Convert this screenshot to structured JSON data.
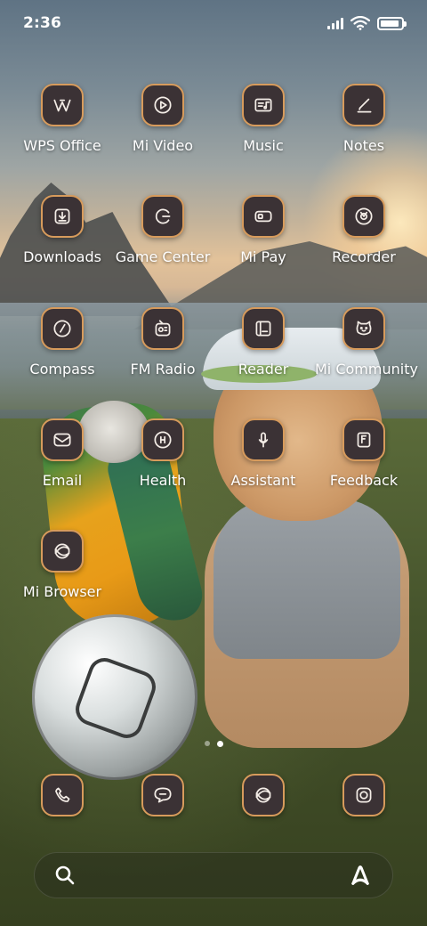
{
  "status_bar": {
    "time": "2:36",
    "signal_icon": "signal-bars-icon",
    "wifi_icon": "wifi-icon",
    "battery_icon": "battery-icon",
    "battery_level": 0.9
  },
  "apps": [
    {
      "label": "WPS Office",
      "icon": "wps-office-icon"
    },
    {
      "label": "Mi Video",
      "icon": "play-icon"
    },
    {
      "label": "Music",
      "icon": "music-card-icon"
    },
    {
      "label": "Notes",
      "icon": "pen-note-icon"
    },
    {
      "label": "Downloads",
      "icon": "download-icon"
    },
    {
      "label": "Game Center",
      "icon": "game-center-icon"
    },
    {
      "label": "Mi Pay",
      "icon": "wallet-card-icon"
    },
    {
      "label": "Recorder",
      "icon": "recorder-icon"
    },
    {
      "label": "Compass",
      "icon": "compass-icon"
    },
    {
      "label": "FM Radio",
      "icon": "radio-icon"
    },
    {
      "label": "Reader",
      "icon": "book-icon"
    },
    {
      "label": "Mi Community",
      "icon": "community-icon"
    },
    {
      "label": "Email",
      "icon": "email-icon"
    },
    {
      "label": "Health",
      "icon": "health-icon"
    },
    {
      "label": "Assistant",
      "icon": "microphone-icon"
    },
    {
      "label": "Feedback",
      "icon": "feedback-icon"
    },
    {
      "label": "Mi Browser",
      "icon": "browser-icon"
    }
  ],
  "page_indicator": {
    "pages": 2,
    "active_index": 1
  },
  "dock": [
    {
      "name": "phone",
      "icon": "phone-icon"
    },
    {
      "name": "messages",
      "icon": "message-icon"
    },
    {
      "name": "browser",
      "icon": "browser-icon"
    },
    {
      "name": "camera",
      "icon": "camera-icon"
    }
  ],
  "search_bar": {
    "search_icon": "search-icon",
    "assistant_icon": "assistant-a-icon"
  },
  "colors": {
    "icon_tile_bg": "#3b3235",
    "icon_tile_border": "#d79b5c",
    "label_text": "#ffffff"
  }
}
